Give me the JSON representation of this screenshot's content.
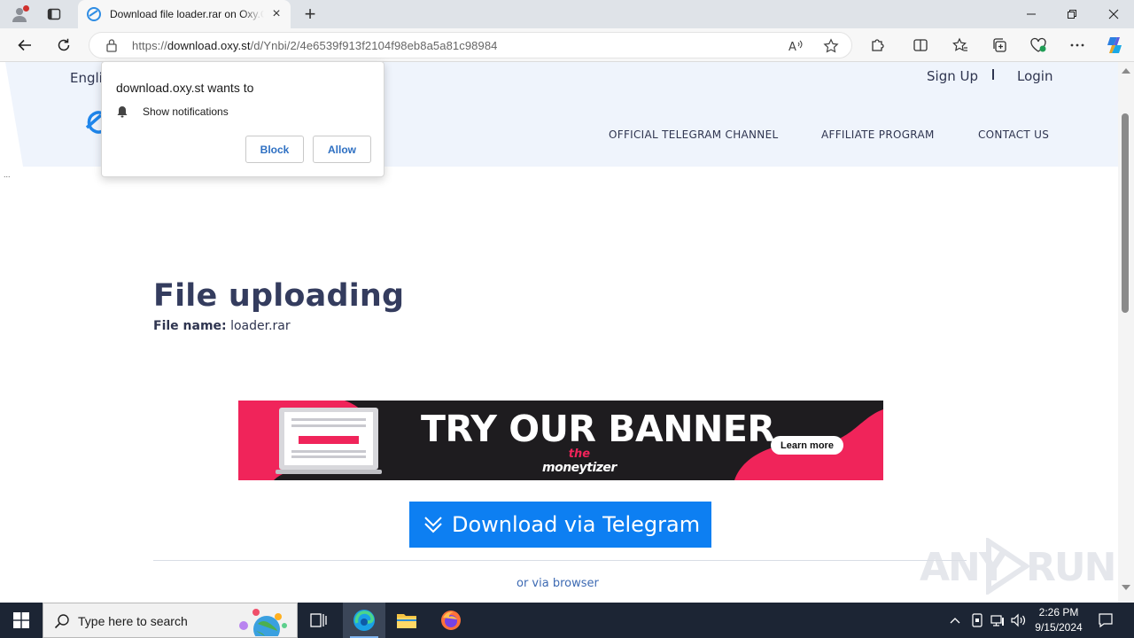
{
  "browser": {
    "tab_title": "Download file loader.rar on Oxy.C",
    "url_prefix": "https://",
    "url_domain": "download.oxy.st",
    "url_path": "/d/Ynbi/2/4e6539f913f2104f98eb8a5a81c98984",
    "new_tab_symbol": "+",
    "tab_close_symbol": "×"
  },
  "header": {
    "language": "Engli",
    "sign_up": "Sign Up",
    "login": "Login",
    "nav": [
      "OFFICIAL TELEGRAM CHANNEL",
      "AFFILIATE PROGRAM",
      "CONTACT US"
    ],
    "ellipsis": "..."
  },
  "main": {
    "title": "File uploading",
    "file_name_label": "File name:",
    "file_name_value": "loader.rar",
    "download_telegram": "Download via Telegram",
    "via_browser": "or via browser"
  },
  "banner": {
    "headline": "TRY OUR BANNER",
    "brand_the": "the",
    "brand_name": "moneytizer",
    "cta": "Learn more"
  },
  "permission_popup": {
    "title": "download.oxy.st wants to",
    "permission": "Show notifications",
    "block": "Block",
    "allow": "Allow"
  },
  "watermark": {
    "text_left": "ANY",
    "text_right": "RUN"
  },
  "taskbar": {
    "search_placeholder": "Type here to search",
    "time": "2:26 PM",
    "date": "9/15/2024"
  },
  "colors": {
    "accent_blue": "#0d7ff2",
    "header_bg": "#eff4fc",
    "title_navy": "#343c5e",
    "banner_pink": "#f0245a",
    "taskbar_bg": "#1c2534"
  }
}
